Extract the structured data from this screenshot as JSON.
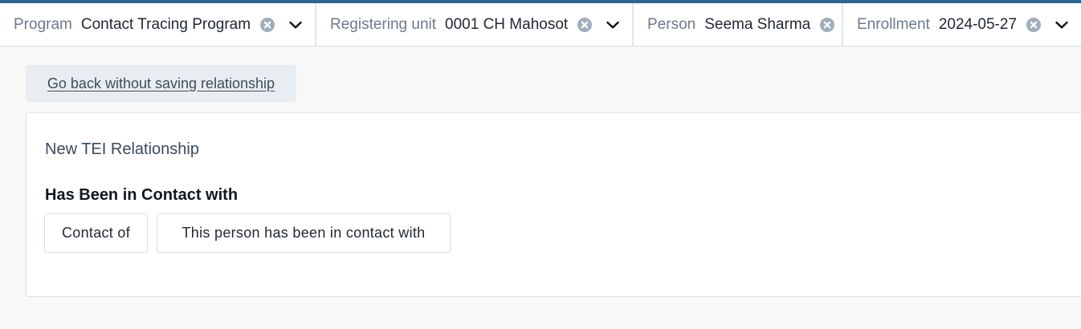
{
  "context_bar": {
    "items": [
      {
        "label": "Program",
        "value": "Contact Tracing Program"
      },
      {
        "label": "Registering unit",
        "value": "0001 CH Mahosot"
      },
      {
        "label": "Person",
        "value": "Seema Sharma"
      },
      {
        "label": "Enrollment",
        "value": "2024-05-27"
      }
    ]
  },
  "actions": {
    "back_label": "Go back without saving relationship"
  },
  "panel": {
    "title": "New TEI Relationship",
    "relationship_type": "Has Been in Contact with",
    "options": [
      "Contact of",
      "This person has been in contact with"
    ]
  },
  "colors": {
    "accent": "#2c6693",
    "clear_icon": "#a0adba",
    "background": "#f8f8f8"
  },
  "icons": {
    "clear": "clear-icon",
    "dropdown": "chevron-down-icon"
  }
}
